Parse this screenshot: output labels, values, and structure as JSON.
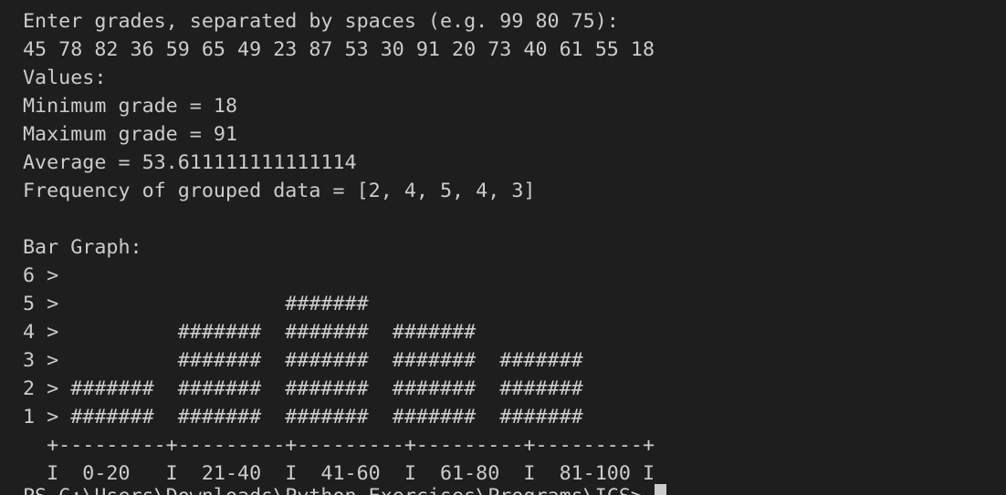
{
  "terminal": {
    "lines": [
      "Enter grades, separated by spaces (e.g. 99 80 75):",
      "45 78 82 36 59 65 49 23 87 53 30 91 20 73 40 61 55 18",
      "Values:",
      "Minimum grade = 18",
      "Maximum grade = 91",
      "Average = 53.611111111111114",
      "Frequency of grouped data = [2, 4, 5, 4, 3]",
      "",
      "Bar Graph:",
      "6 >",
      "5 >                   #######",
      "4 >          #######  #######  #######",
      "3 >          #######  #######  #######  #######",
      "2 > #######  #######  #######  #######  #######",
      "1 > #######  #######  #######  #######  #######",
      "  +---------+---------+---------+---------+---------+",
      "  I  0-20   I  21-40  I  41-60  I  61-80  I  81-100 I"
    ],
    "prompt": "PS C:\\Users\\Downloads\\Python Exercises\\Programs\\ICS> "
  }
}
